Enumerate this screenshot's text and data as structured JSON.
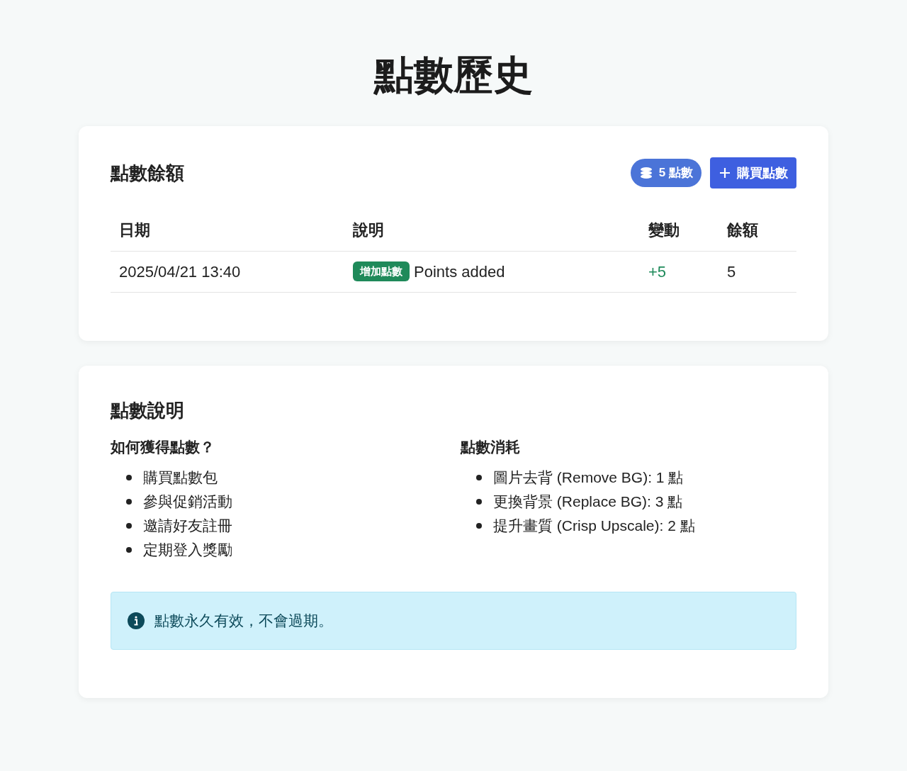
{
  "page_title": "點數歷史",
  "balance_card": {
    "title": "點數餘額",
    "balance_badge": "5 點數",
    "buy_button": "購買點數",
    "table": {
      "columns": [
        "日期",
        "說明",
        "變動",
        "餘額"
      ],
      "rows": [
        {
          "date": "2025/04/21 13:40",
          "tag": "增加點數",
          "description": "Points added",
          "change": "+5",
          "kind": "increase",
          "balance": "5"
        }
      ]
    }
  },
  "info_card": {
    "title": "點數說明",
    "sections": [
      {
        "heading": "如何獲得點數？",
        "items": [
          "購買點數包",
          "參與促銷活動",
          "邀請好友註冊",
          "定期登入獎勵"
        ]
      },
      {
        "heading": "點數消耗",
        "items": [
          "圖片去背 (Remove BG): 1 點",
          "更換背景 (Replace BG): 3 點",
          "提升畫質 (Crisp Upscale): 2 點"
        ]
      }
    ],
    "notice": "點數永久有效，不會過期。"
  }
}
